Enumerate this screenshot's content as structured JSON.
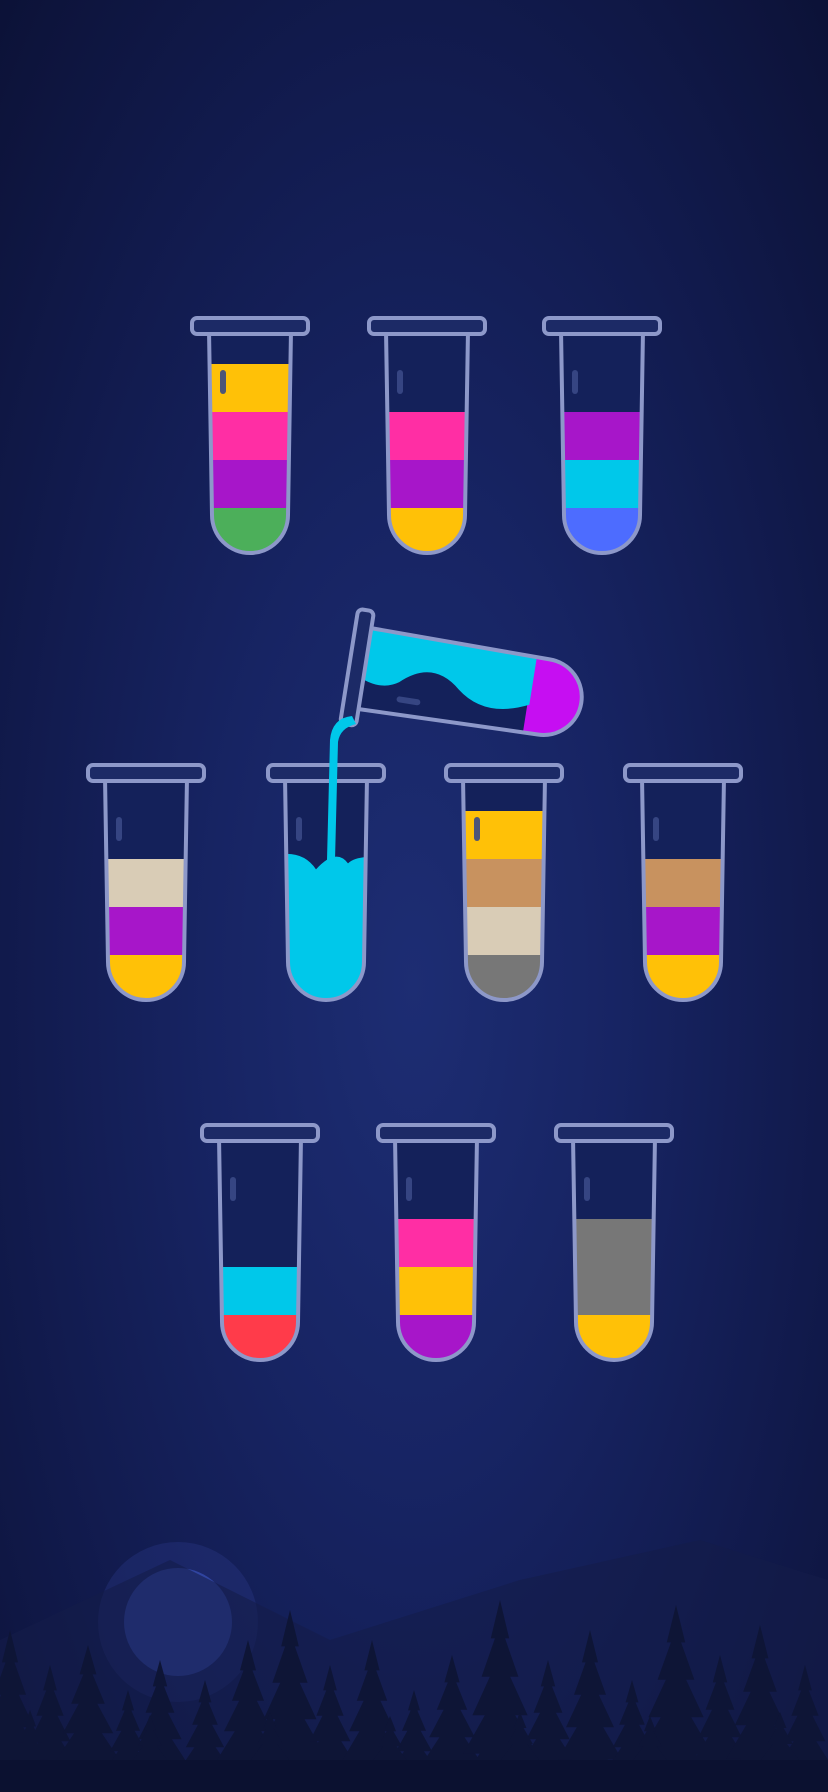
{
  "game": {
    "title": "",
    "colors": {
      "yellow": "#ffc107",
      "pink": "#ff2ea4",
      "purple": "#a716c9",
      "green": "#4caf5a",
      "cyan": "#00c8ea",
      "blue": "#4d6cff",
      "cream": "#d9ccb6",
      "tan": "#c8925f",
      "gray": "#777777",
      "red": "#ff3b4a",
      "magenta": "#c60ef2",
      "background": "#172463"
    },
    "tube_capacity": 4,
    "tubes": [
      {
        "id": "tube-1",
        "layers": [
          "green",
          "purple",
          "pink",
          "yellow"
        ]
      },
      {
        "id": "tube-2",
        "layers": [
          "yellow",
          "purple",
          "pink"
        ]
      },
      {
        "id": "tube-3",
        "layers": [
          "blue",
          "cyan",
          "purple"
        ]
      },
      {
        "id": "tube-4",
        "layers": [
          "yellow",
          "purple",
          "cream"
        ]
      },
      {
        "id": "tube-5",
        "layers": [
          "cyan"
        ],
        "fill_fraction": 0.7,
        "receiving_pour": true
      },
      {
        "id": "tube-6",
        "layers": [
          "gray",
          "cream",
          "tan",
          "yellow"
        ]
      },
      {
        "id": "tube-7",
        "layers": [
          "yellow",
          "purple",
          "tan"
        ]
      },
      {
        "id": "tube-8",
        "layers": [
          "red",
          "cyan"
        ]
      },
      {
        "id": "tube-9",
        "layers": [
          "purple",
          "yellow",
          "pink"
        ]
      },
      {
        "id": "tube-10",
        "layers": [
          "yellow",
          "gray",
          "gray"
        ]
      }
    ],
    "pouring_tube": {
      "id": "tube-pouring",
      "layers": [
        "magenta",
        "cyan"
      ],
      "pouring_color": "cyan",
      "target": "tube-5"
    },
    "scenery": {
      "moon": true,
      "forest": true
    }
  }
}
